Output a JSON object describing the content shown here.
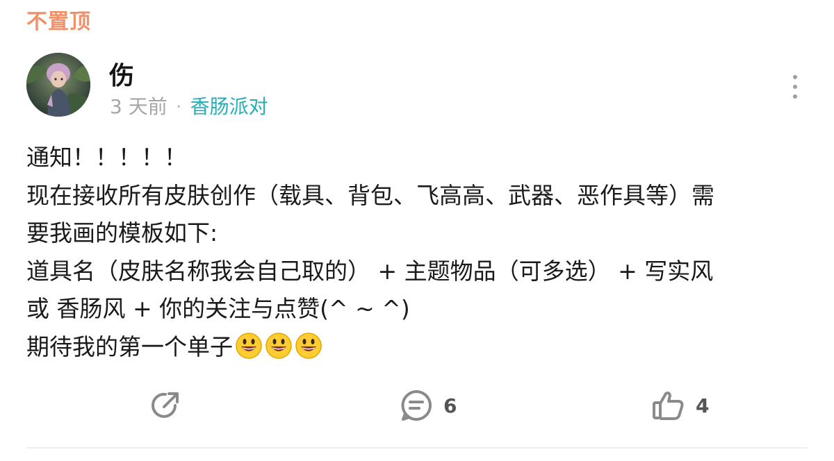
{
  "pin": {
    "label": "不置顶"
  },
  "author": {
    "name": "伤",
    "avatar_icon": "user-avatar"
  },
  "meta": {
    "time": "3 天前",
    "separator": "·",
    "circle": "香肠派对"
  },
  "post": {
    "lines": [
      "通知！！！！！",
      "现在接收所有皮肤创作（载具、背包、飞高高、武器、恶作具等）需",
      "要我画的模板如下:",
      "道具名（皮肤名称我会自己取的） + 主题物品（可多选） + 写实风",
      "或  香肠风 + 你的关注与点赞(^ ~ ^)",
      "期待我的第一个单子"
    ],
    "emoji_icon": "smiling-face-emoji",
    "emoji_count": 3
  },
  "actions": {
    "share_icon": "share-icon",
    "comment_icon": "comment-icon",
    "comment_count": "6",
    "like_icon": "thumbs-up-icon",
    "like_count": "4"
  },
  "colors": {
    "pin": "#f0916a",
    "circle_link": "#23aeb8",
    "meta_text": "#a6a6a6",
    "icon": "#8a8a8a"
  }
}
